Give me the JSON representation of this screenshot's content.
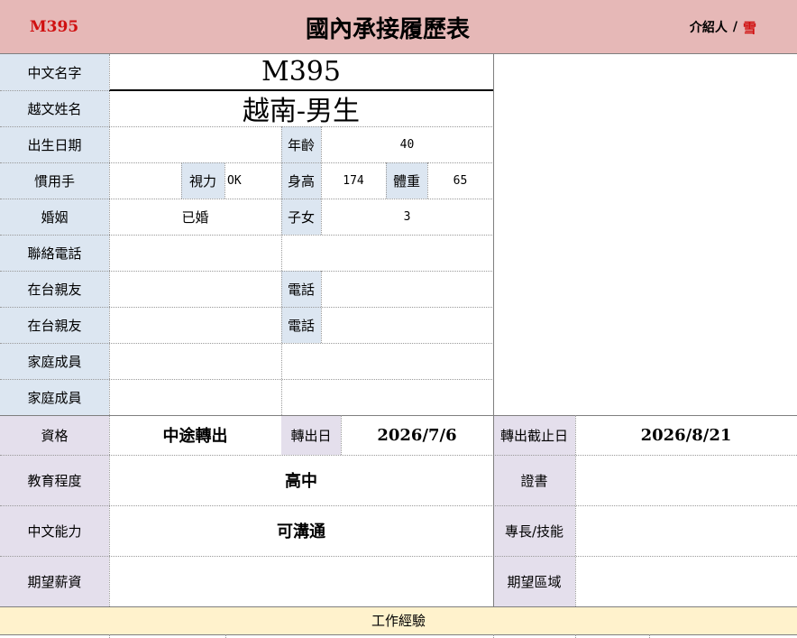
{
  "header": {
    "code": "M395",
    "title": "國內承接履歷表",
    "introducer_label": "介紹人",
    "introducer_sep": "/",
    "introducer_value": "雪"
  },
  "personal": {
    "chinese_name_label": "中文名字",
    "chinese_name_value": "M395",
    "vietnamese_name_label": "越文姓名",
    "vietnamese_name_value": "越南-男生",
    "birthdate_label": "出生日期",
    "birthdate_value": "",
    "age_label": "年齡",
    "age_value": "40",
    "handedness_label": "慣用手",
    "handedness_value": "",
    "vision_label": "視力",
    "vision_value": "OK",
    "height_label": "身高",
    "height_value": "174",
    "weight_label": "體重",
    "weight_value": "65",
    "marriage_label": "婚姻",
    "marriage_value": "已婚",
    "children_label": "子女",
    "children_value": "3",
    "contact_phone_label": "聯絡電話",
    "relative1_label": "在台親友",
    "relative1_phone_label": "電話",
    "relative2_label": "在台親友",
    "relative2_phone_label": "電話",
    "family1_label": "家庭成員",
    "family2_label": "家庭成員"
  },
  "qualification": {
    "status_label": "資格",
    "status_value": "中途轉出",
    "transfer_date_label": "轉出日",
    "transfer_date_value": "2026/7/6",
    "deadline_label": "轉出截止日",
    "deadline_value": "2026/8/21",
    "education_label": "教育程度",
    "education_value": "高中",
    "certificate_label": "證書",
    "chinese_ability_label": "中文能力",
    "chinese_ability_value": "可溝通",
    "skills_label": "專長/技能",
    "salary_label": "期望薪資",
    "region_label": "期望區域"
  },
  "footer": {
    "work_experience_label": "工作經驗"
  },
  "colors": {
    "header_bg": "#e6b8b7",
    "label_blue": "#dce6f1",
    "label_purple": "#e4dfec",
    "footer_bg": "#fff2cc",
    "accent_red": "#d01010"
  }
}
